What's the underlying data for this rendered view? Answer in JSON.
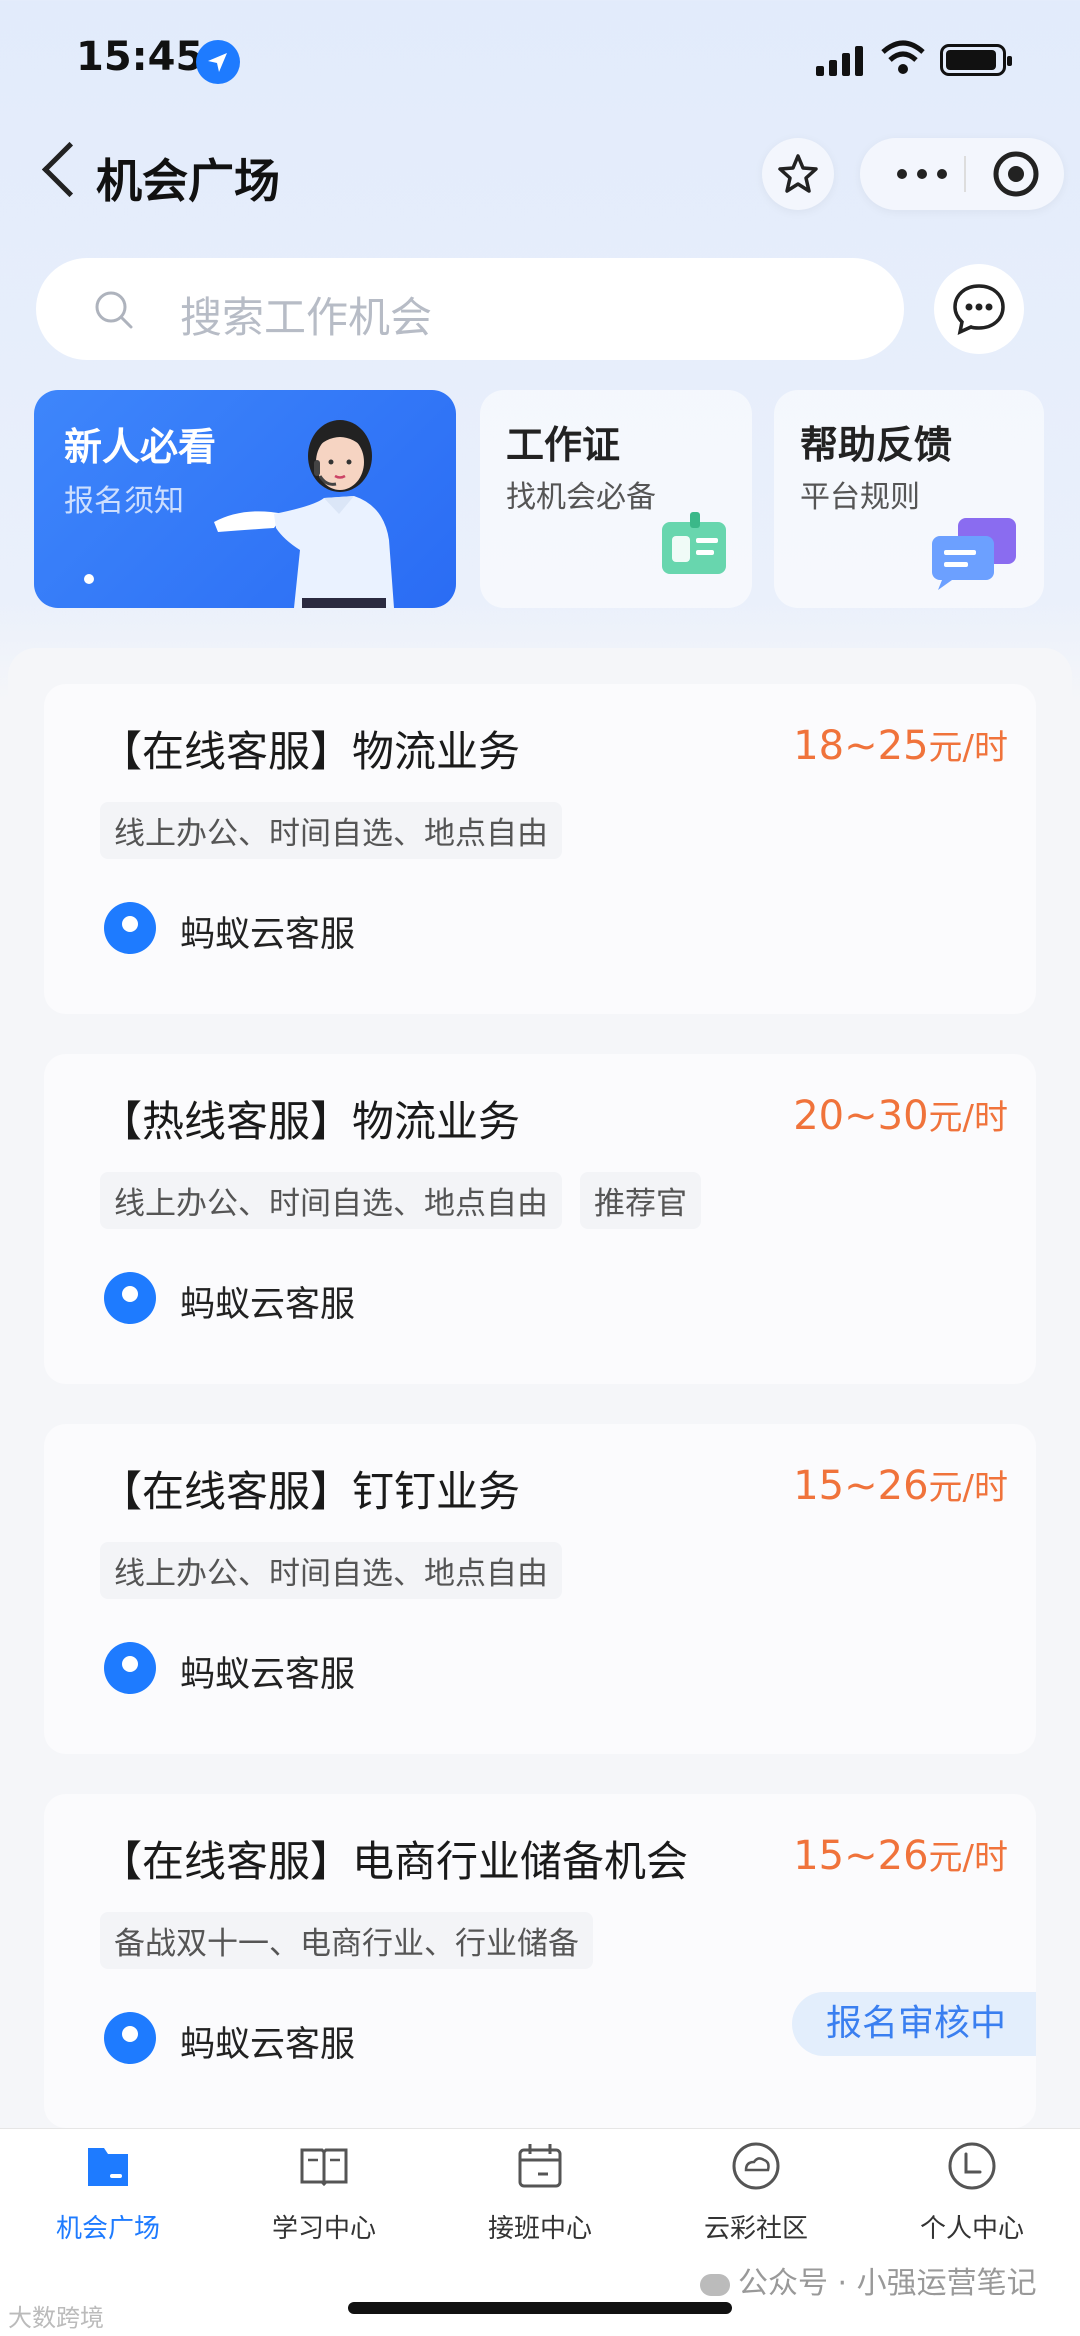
{
  "status_bar": {
    "time": "15:45"
  },
  "header": {
    "title": "机会广场"
  },
  "search": {
    "placeholder": "搜索工作机会"
  },
  "features": [
    {
      "title": "新人必看",
      "subtitle": "报名须知"
    },
    {
      "title": "工作证",
      "subtitle": "找机会必备"
    },
    {
      "title": "帮助反馈",
      "subtitle": "平台规则"
    }
  ],
  "jobs": [
    {
      "title": "【在线客服】物流业务",
      "salary": "18~25",
      "unit": "元/时",
      "tags": [
        "线上办公、时间自选、地点自由"
      ],
      "company": "蚂蚁云客服"
    },
    {
      "title": "【热线客服】物流业务",
      "salary": "20~30",
      "unit": "元/时",
      "tags": [
        "线上办公、时间自选、地点自由",
        "推荐官"
      ],
      "company": "蚂蚁云客服"
    },
    {
      "title": "【在线客服】钉钉业务",
      "salary": "15~26",
      "unit": "元/时",
      "tags": [
        "线上办公、时间自选、地点自由"
      ],
      "company": "蚂蚁云客服"
    },
    {
      "title": "【在线客服】电商行业储备机会",
      "salary": "15~26",
      "unit": "元/时",
      "tags": [
        "备战双十一、电商行业、行业储备"
      ],
      "company": "蚂蚁云客服",
      "status": "报名审核中"
    }
  ],
  "tabs": [
    {
      "label": "机会广场",
      "icon": "folder-icon",
      "active": true
    },
    {
      "label": "学习中心",
      "icon": "book-icon"
    },
    {
      "label": "接班中心",
      "icon": "calendar-icon"
    },
    {
      "label": "云彩社区",
      "icon": "cloud-icon"
    },
    {
      "label": "个人中心",
      "icon": "user-icon"
    }
  ],
  "watermark": {
    "left": "大数跨境",
    "right": "公众号 · 小强运营笔记"
  },
  "colors": {
    "accent": "#1e7bff",
    "salary": "#f0733b"
  }
}
